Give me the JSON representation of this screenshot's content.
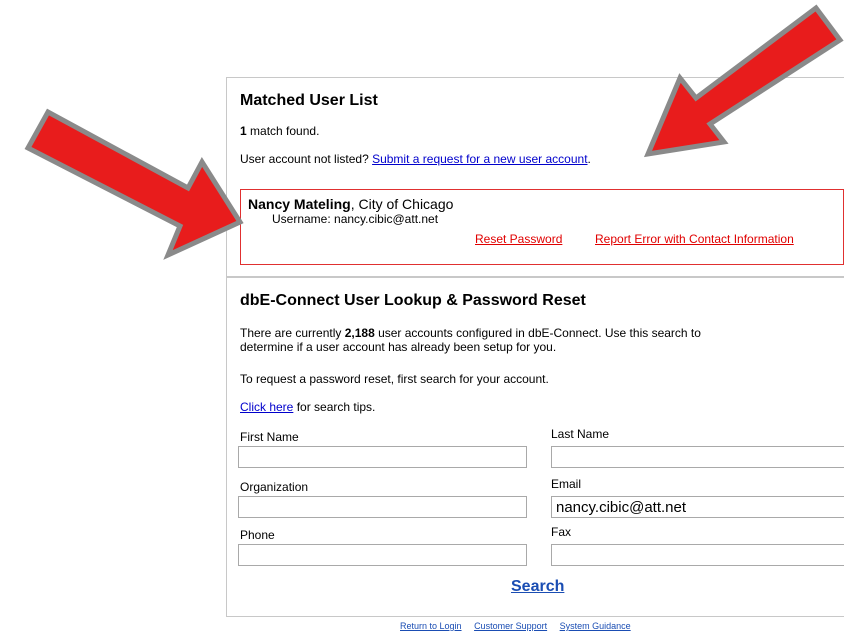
{
  "matched": {
    "title": "Matched User List",
    "count": "1",
    "count_suffix": " match found.",
    "not_listed_prefix": "User account not listed? ",
    "request_link": "Submit a request for a new user account",
    "request_suffix": ".",
    "user": {
      "name": "Nancy Mateling",
      "org": ", City of Chicago",
      "username_label": "Username: ",
      "username": "nancy.cibic@att.net",
      "reset_link": "Reset Password",
      "report_link": "Report Error with Contact Information"
    }
  },
  "lookup": {
    "title": "dbE-Connect User Lookup & Password Reset",
    "intro_prefix": "There are currently ",
    "intro_count": "2,188",
    "intro_suffix": " user accounts configured in dbE-Connect. Use this search to",
    "intro_line2": "determine if a user account has already been setup for you.",
    "reset_text": "To request a password reset, first search for your account.",
    "tips_link": "Click here",
    "tips_suffix": " for search tips.",
    "fields": {
      "first_name": {
        "label": "First Name",
        "value": ""
      },
      "last_name": {
        "label": "Last Name",
        "value": ""
      },
      "organization": {
        "label": "Organization",
        "value": ""
      },
      "email": {
        "label": "Email",
        "value": "nancy.cibic@att.net"
      },
      "phone": {
        "label": "Phone",
        "value": ""
      },
      "fax": {
        "label": "Fax",
        "value": ""
      }
    },
    "search_label": "Search"
  },
  "footer": {
    "login": "Return to Login",
    "support": "Customer Support",
    "guidance": "System Guidance"
  },
  "annotations": {
    "arrow_color": "#e81c1c",
    "arrow_outline": "#8a8a8a"
  }
}
